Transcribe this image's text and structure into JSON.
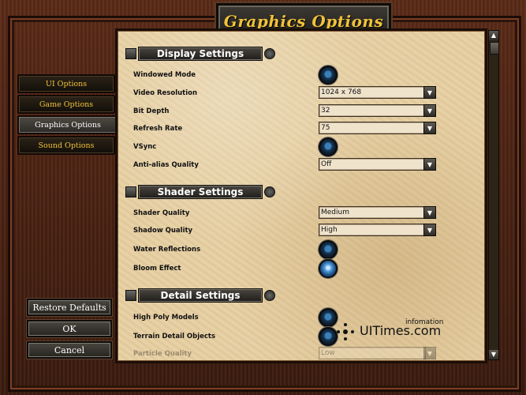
{
  "title": "Graphics Options",
  "sidebar": {
    "items": [
      {
        "label": "UI Options",
        "active": false
      },
      {
        "label": "Game Options",
        "active": false
      },
      {
        "label": "Graphics Options",
        "active": true
      },
      {
        "label": "Sound Options",
        "active": false
      }
    ]
  },
  "bottom_buttons": [
    {
      "label": "Restore Defaults"
    },
    {
      "label": "OK"
    },
    {
      "label": "Cancel"
    }
  ],
  "sections": [
    {
      "title": "Display Settings"
    },
    {
      "title": "Shader Settings"
    },
    {
      "title": "Detail Settings"
    }
  ],
  "settings": {
    "windowed_mode": {
      "label": "Windowed Mode",
      "type": "toggle",
      "state": "off"
    },
    "video_resolution": {
      "label": "Video Resolution",
      "type": "select",
      "value": "1024 x 768"
    },
    "bit_depth": {
      "label": "Bit Depth",
      "type": "select",
      "value": "32"
    },
    "refresh_rate": {
      "label": "Refresh Rate",
      "type": "select",
      "value": "75"
    },
    "vsync": {
      "label": "VSync",
      "type": "toggle",
      "state": "off"
    },
    "anti_alias_quality": {
      "label": "Anti-alias Quality",
      "type": "select",
      "value": "Off"
    },
    "shader_quality": {
      "label": "Shader Quality",
      "type": "select",
      "value": "Medium"
    },
    "shadow_quality": {
      "label": "Shadow Quality",
      "type": "select",
      "value": "High"
    },
    "water_reflections": {
      "label": "Water Reflections",
      "type": "toggle",
      "state": "off"
    },
    "bloom_effect": {
      "label": "Bloom Effect",
      "type": "toggle",
      "state": "on"
    },
    "high_poly_models": {
      "label": "High Poly Models",
      "type": "toggle",
      "state": "off"
    },
    "terrain_detail_objects": {
      "label": "Terrain Detail Objects",
      "type": "toggle",
      "state": "off"
    },
    "particle_quality": {
      "label": "Particle Quality",
      "type": "select",
      "value": "Low"
    }
  },
  "watermark": {
    "brand": "UITimes.com",
    "tag": "infomation"
  },
  "icons": {
    "dropdown": "▼",
    "scroll_up": "▲",
    "scroll_down": "▼"
  },
  "colors": {
    "gold": "#f0c23a",
    "parchment": "#e6cfa2",
    "wood": "#5a2a17"
  }
}
